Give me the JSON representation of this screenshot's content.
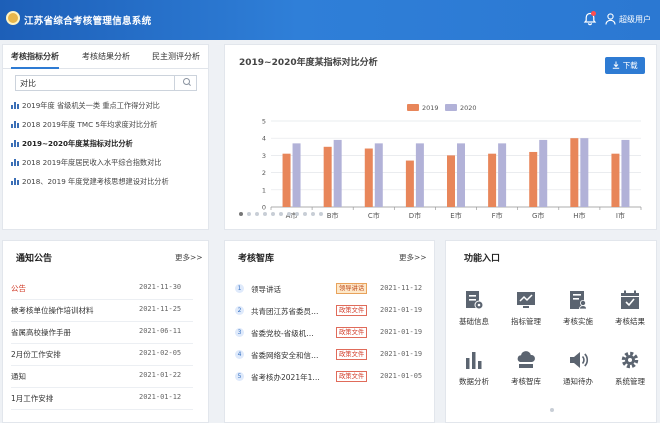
{
  "header": {
    "title": "江苏省综合考核管理信息系统",
    "user": "超级用户"
  },
  "analysis": {
    "tabs": [
      "考核指标分析",
      "考核结果分析",
      "民主测评分析"
    ],
    "search_value": "对比",
    "items": [
      "2019年度 省级机关一类 重点工作得分对比",
      "2018 2019年度 TMC 5年均求度对比分析",
      "2019~2020年度某指标对比分析",
      "2018 2019年度居民收入水平综合指数对比",
      "2018、2019 年度党建考核思想建设对比分析"
    ]
  },
  "chart_panel": {
    "title": "2019~2020年度某指标对比分析",
    "download": "下载"
  },
  "chart_data": {
    "type": "bar",
    "categories": [
      "A市",
      "B市",
      "C市",
      "D市",
      "E市",
      "F市",
      "G市",
      "H市",
      "I市"
    ],
    "series": [
      {
        "name": "2019",
        "values": [
          3.1,
          3.5,
          3.4,
          2.7,
          3.0,
          3.1,
          3.2,
          4.0,
          3.1
        ]
      },
      {
        "name": "2020",
        "values": [
          3.7,
          3.9,
          3.7,
          3.7,
          3.7,
          3.7,
          3.9,
          4.0,
          3.9
        ]
      }
    ],
    "ylim": [
      0,
      5
    ],
    "yticks": [
      "0",
      "1",
      "2",
      "3",
      "4",
      "5"
    ],
    "legend": "top-center",
    "colors": [
      "#e8865a",
      "#b2b2d8"
    ]
  },
  "notice": {
    "title": "通知公告",
    "more": "更多>>",
    "items": [
      {
        "title": "公告",
        "date": "2021-11-30"
      },
      {
        "title": "被考核单位操作培训材料",
        "date": "2021-11-25"
      },
      {
        "title": "省属高校操作手册",
        "date": "2021-06-11"
      },
      {
        "title": "2月份工作安排",
        "date": "2021-02-05"
      },
      {
        "title": "通知",
        "date": "2021-01-22"
      },
      {
        "title": "1月工作安排",
        "date": "2021-01-12"
      }
    ]
  },
  "library": {
    "title": "考核智库",
    "more": "更多>>",
    "items": [
      {
        "no": "1",
        "title": "领导讲话",
        "tag": "领导讲话",
        "date": "2021-11-12"
      },
      {
        "no": "2",
        "title": "共青团江苏省委员…",
        "tag": "政策文件",
        "date": "2021-01-19"
      },
      {
        "no": "3",
        "title": "省委党校-省级机…",
        "tag": "政策文件",
        "date": "2021-01-19"
      },
      {
        "no": "4",
        "title": "省委网络安全和信…",
        "tag": "政策文件",
        "date": "2021-01-19"
      },
      {
        "no": "5",
        "title": "省考核办2021年1…",
        "tag": "政策文件",
        "date": "2021-01-05"
      }
    ]
  },
  "functions": {
    "title": "功能入口",
    "items": [
      "基础信息",
      "指标管理",
      "考核实施",
      "考核结果",
      "数据分析",
      "考核智库",
      "通知待办",
      "系统管理"
    ]
  },
  "colors": {
    "primary": "#2e7bd3",
    "tag_red": "#d23d2a"
  }
}
